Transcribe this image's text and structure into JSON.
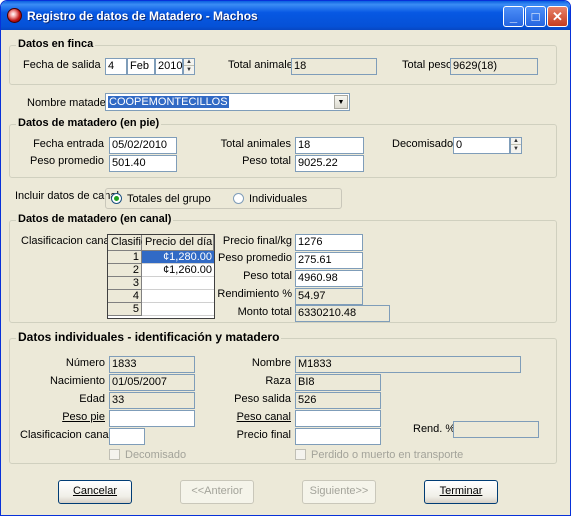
{
  "window": {
    "title": "Registro de datos de Matadero - Machos"
  },
  "finca": {
    "title": "Datos en finca",
    "fecha_salida_label": "Fecha de salida",
    "day": "4",
    "month": "Feb",
    "year": "2010",
    "total_animales_label": "Total animales",
    "total_animales": "18",
    "total_peso_label": "Total peso",
    "total_peso": "9629(18)"
  },
  "matadero_name": {
    "label": "Nombre matadero",
    "value": "COOPEMONTECILLOS"
  },
  "pie": {
    "title": "Datos de matadero (en pie)",
    "fecha_entrada_label": "Fecha entrada",
    "fecha_entrada": "05/02/2010",
    "peso_promedio_label": "Peso promedio",
    "peso_promedio": "501.40",
    "total_animales_label": "Total animales",
    "total_animales": "18",
    "peso_total_label": "Peso total",
    "peso_total": "9025.22",
    "decomisados_label": "Decomisados",
    "decomisados": "0"
  },
  "canal_option": {
    "label": "Incluir datos de canal",
    "opt1": "Totales del grupo",
    "opt2": "Individuales"
  },
  "canal": {
    "title": "Datos de matadero (en canal)",
    "clasificacion_label": "Clasificacion canal",
    "grid_headers": [
      "Clasific",
      "Precio del día"
    ],
    "rows": [
      {
        "n": "1",
        "price": "¢1,280.00"
      },
      {
        "n": "2",
        "price": "¢1,260.00"
      },
      {
        "n": "3",
        "price": ""
      },
      {
        "n": "4",
        "price": ""
      },
      {
        "n": "5",
        "price": ""
      }
    ],
    "precio_final_label": "Precio final/kg",
    "precio_final": "1276",
    "peso_promedio_label": "Peso promedio",
    "peso_promedio": "275.61",
    "peso_total_label": "Peso total",
    "peso_total": "4960.98",
    "rendimiento_label": "Rendimiento %",
    "rendimiento": "54.97",
    "monto_total_label": "Monto total",
    "monto_total": "6330210.48"
  },
  "individual": {
    "title": "Datos individuales - identificación y matadero",
    "numero_label": "Número",
    "numero": "1833",
    "nacimiento_label": "Nacimiento",
    "nacimiento": "01/05/2007",
    "edad_label": "Edad",
    "edad": "33",
    "peso_pie_label": "Peso pie",
    "peso_pie": "",
    "clasificacion_label": "Clasificacion canal",
    "clasificacion": "",
    "decomisado_label": "Decomisado",
    "nombre_label": "Nombre",
    "nombre": "M1833",
    "raza_label": "Raza",
    "raza": "BI8",
    "peso_salida_label": "Peso salida",
    "peso_salida": "526",
    "peso_canal_label": "Peso canal",
    "peso_canal": "",
    "precio_final_label": "Precio final",
    "precio_final": "",
    "rend_label": "Rend. %",
    "rend": "",
    "perdido_label": "Perdido o muerto en transporte"
  },
  "buttons": {
    "cancelar": "Cancelar",
    "anterior": "<<Anterior",
    "siguiente": "Siguiente>>",
    "terminar": "Terminar"
  }
}
